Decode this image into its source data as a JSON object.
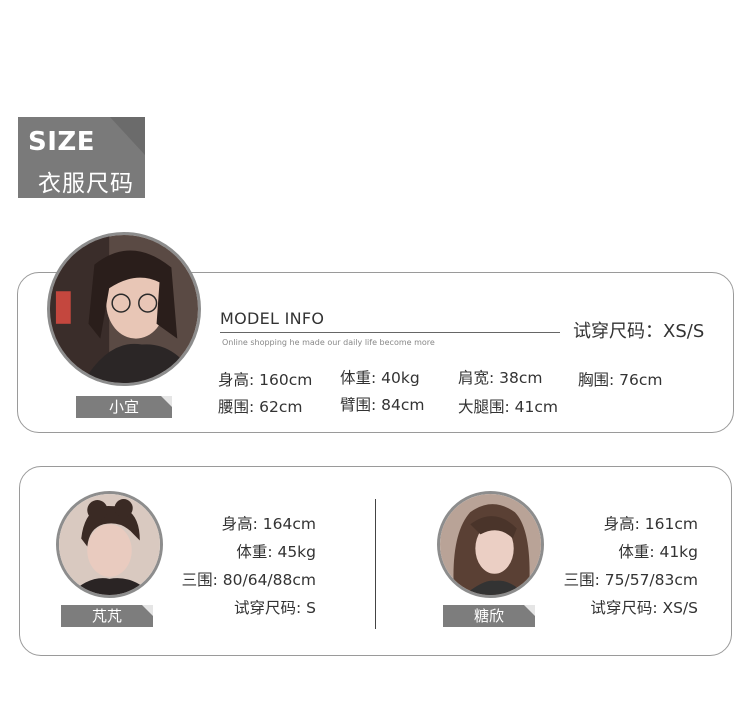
{
  "header": {
    "size_en": "SIZE",
    "size_zh": "衣服尺码"
  },
  "model1": {
    "name": "小宜",
    "info_title": "MODEL INFO",
    "info_subtitle": "Online shopping he made our daily life become more",
    "try_size": "试穿尺码：XS/S",
    "stats": {
      "height": "身高: 160cm",
      "weight": "体重: 40kg",
      "shoulder": "肩宽: 38cm",
      "chest": "胸围: 76cm",
      "waist": "腰围: 62cm",
      "arm": "臂围: 84cm",
      "thigh": "大腿围: 41cm"
    }
  },
  "model2": {
    "name": "芃芃",
    "height": "身高: 164cm",
    "weight": "体重: 45kg",
    "measurements": "三围: 80/64/88cm",
    "try_size": "试穿尺码: S"
  },
  "model3": {
    "name": "糖欣",
    "height": "身高: 161cm",
    "weight": "体重: 41kg",
    "measurements": "三围: 75/57/83cm",
    "try_size": "试穿尺码: XS/S"
  }
}
